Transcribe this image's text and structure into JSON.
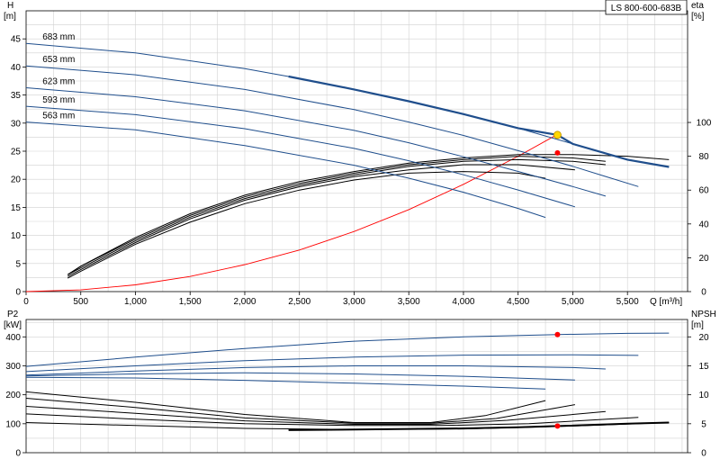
{
  "title": "LS 800-600-683B",
  "colors": {
    "blue": "#1f4e8c",
    "black": "#000000",
    "grid": "#d2d2d2",
    "red": "#ff0000",
    "opPoint": "#ffd700"
  },
  "chart_data": [
    {
      "type": "line",
      "name": "head-efficiency",
      "xlabel": "Q [m³/h]",
      "ylabel_left": "H",
      "ylabel_left_unit": "[m]",
      "ylabel_right": "eta",
      "ylabel_right_unit": "[%]",
      "xlim": [
        0,
        6050
      ],
      "ylim_left": [
        0,
        50
      ],
      "ylim_right": [
        0,
        166
      ],
      "x_ticks": [
        "0",
        "500",
        "1,000",
        "1,500",
        "2,000",
        "2,500",
        "3,000",
        "3,500",
        "4,000",
        "4,500",
        "5,000",
        "5,500"
      ],
      "x_tick_values": [
        0,
        500,
        1000,
        1500,
        2000,
        2500,
        3000,
        3500,
        4000,
        4500,
        5000,
        5500
      ],
      "y_left_ticks": [
        "0",
        "5",
        "10",
        "15",
        "20",
        "25",
        "30",
        "35",
        "40",
        "45"
      ],
      "y_left_tick_values": [
        0,
        5,
        10,
        15,
        20,
        25,
        30,
        35,
        40,
        45
      ],
      "y_right_ticks": [
        "0",
        "20",
        "40",
        "60",
        "80",
        "100"
      ],
      "y_right_tick_values": [
        0,
        20,
        40,
        60,
        80,
        100
      ],
      "head_curves": [
        {
          "name": "683 mm",
          "x": [
            0,
            1000,
            2000,
            2400,
            3000,
            3500,
            4000,
            4500,
            5000,
            5500,
            5880
          ],
          "y": [
            44.2,
            42.5,
            39.7,
            38.3,
            36.0,
            33.9,
            31.6,
            29.1,
            26.3,
            23.5,
            22.2
          ]
        },
        {
          "name": "653 mm",
          "x": [
            0,
            1000,
            2000,
            3000,
            3500,
            4000,
            4500,
            5000,
            5300,
            5600
          ],
          "y": [
            40.2,
            38.6,
            36.0,
            32.4,
            30.2,
            27.8,
            25.1,
            22.3,
            20.5,
            18.7
          ]
        },
        {
          "name": "623 mm",
          "x": [
            0,
            1000,
            2000,
            3000,
            3500,
            4000,
            4500,
            5000,
            5300
          ],
          "y": [
            36.3,
            34.7,
            32.2,
            28.7,
            26.5,
            24.0,
            21.4,
            18.7,
            17.0
          ]
        },
        {
          "name": "593 mm",
          "x": [
            0,
            1000,
            2000,
            3000,
            3500,
            4000,
            4500,
            5020
          ],
          "y": [
            33.0,
            31.5,
            29.0,
            25.5,
            23.3,
            20.8,
            18.1,
            15.1
          ]
        },
        {
          "name": "563 mm",
          "x": [
            0,
            1000,
            2000,
            3000,
            3500,
            4000,
            4500,
            4750
          ],
          "y": [
            30.2,
            28.8,
            26.0,
            22.5,
            20.2,
            17.7,
            14.8,
            13.2
          ]
        }
      ],
      "highlight_curve": {
        "name": "683 mm",
        "x": [
          2400,
          3000,
          3500,
          4000,
          4500,
          4860,
          5000,
          5500,
          5880
        ],
        "y": [
          38.3,
          36.0,
          33.9,
          31.6,
          29.1,
          27.9,
          26.3,
          23.5,
          22.2
        ]
      },
      "efficiency_curves": [
        {
          "x": [
            380,
            500,
            1000,
            1500,
            2000,
            2500,
            3000,
            3500,
            4000,
            4500,
            5000,
            5500,
            5880
          ],
          "eta": [
            10,
            15,
            32,
            46,
            57,
            65,
            71,
            76,
            79,
            81,
            81,
            80,
            78
          ]
        },
        {
          "x": [
            380,
            500,
            1000,
            1500,
            2000,
            2500,
            3000,
            3500,
            4000,
            4500,
            5000,
            5300
          ],
          "eta": [
            10,
            15,
            31,
            45,
            56,
            64,
            70,
            75,
            78,
            80,
            79,
            77
          ]
        },
        {
          "x": [
            380,
            500,
            1000,
            1500,
            2000,
            2500,
            3000,
            3500,
            4000,
            4500,
            5000,
            5300
          ],
          "eta": [
            10,
            14,
            30,
            44,
            55,
            63,
            69,
            74,
            77,
            78,
            77,
            75
          ]
        },
        {
          "x": [
            380,
            500,
            1000,
            1500,
            2000,
            2500,
            3000,
            3500,
            4000,
            4500,
            5020
          ],
          "eta": [
            9,
            13,
            29,
            43,
            54,
            62,
            68,
            72,
            75,
            75,
            72
          ]
        },
        {
          "x": [
            380,
            500,
            1000,
            1500,
            2000,
            2500,
            3000,
            3500,
            4000,
            4500,
            4750
          ],
          "eta": [
            8,
            12,
            28,
            41,
            52,
            60,
            66,
            70,
            71,
            70,
            67
          ]
        }
      ],
      "system_curve": {
        "x": [
          0,
          500,
          1000,
          1500,
          2000,
          2500,
          3000,
          3500,
          4000,
          4500,
          4860
        ],
        "y": [
          0,
          0.3,
          1.2,
          2.7,
          4.8,
          7.4,
          10.7,
          14.6,
          19.1,
          24.1,
          28.0
        ]
      },
      "operating_point": {
        "x": 4860,
        "y": 27.9,
        "eta": 82
      }
    },
    {
      "type": "line",
      "name": "power-npsh",
      "ylabel_left": "P2",
      "ylabel_left_unit": "[kW]",
      "ylabel_right": "NPSH",
      "ylabel_right_unit": "[m]",
      "xlim": [
        0,
        6050
      ],
      "ylim_left": [
        0,
        460
      ],
      "ylim_right": [
        0,
        23
      ],
      "y_left_ticks": [
        "0",
        "100",
        "200",
        "300",
        "400"
      ],
      "y_left_tick_values": [
        0,
        100,
        200,
        300,
        400
      ],
      "y_right_ticks": [
        "0",
        "5",
        "10",
        "15",
        "20"
      ],
      "y_right_tick_values": [
        0,
        5,
        10,
        15,
        20
      ],
      "power_curves": [
        {
          "x": [
            0,
            1000,
            2000,
            3000,
            4000,
            4860,
            5500,
            5880
          ],
          "y": [
            298,
            330,
            360,
            385,
            400,
            408,
            412,
            413
          ]
        },
        {
          "x": [
            0,
            1000,
            2000,
            3000,
            4000,
            5000,
            5600
          ],
          "y": [
            280,
            300,
            318,
            330,
            337,
            338,
            336
          ]
        },
        {
          "x": [
            0,
            1000,
            2000,
            3000,
            4000,
            5000,
            5300
          ],
          "y": [
            268,
            282,
            294,
            300,
            300,
            294,
            289
          ]
        },
        {
          "x": [
            0,
            1000,
            2000,
            3000,
            4000,
            5020
          ],
          "y": [
            265,
            272,
            276,
            272,
            264,
            251
          ]
        },
        {
          "x": [
            0,
            1000,
            2000,
            3000,
            4000,
            4750
          ],
          "y": [
            260,
            258,
            250,
            240,
            230,
            220
          ]
        }
      ],
      "npsh_curves": [
        {
          "x": [
            0,
            1000,
            2000,
            3000,
            3700,
            4200,
            4750
          ],
          "y": [
            10.5,
            8.7,
            6.6,
            5.2,
            5.2,
            6.4,
            9.0
          ]
        },
        {
          "x": [
            0,
            1000,
            2000,
            3000,
            3700,
            4300,
            5020
          ],
          "y": [
            9.4,
            7.8,
            6.0,
            5.1,
            5.1,
            5.9,
            8.3
          ]
        },
        {
          "x": [
            0,
            1000,
            2000,
            3000,
            3700,
            4400,
            5300
          ],
          "y": [
            8.0,
            6.8,
            5.5,
            4.9,
            4.9,
            5.6,
            7.1
          ]
        },
        {
          "x": [
            0,
            1000,
            2000,
            3000,
            3800,
            4600,
            5600
          ],
          "y": [
            6.7,
            5.8,
            5.0,
            4.7,
            4.7,
            5.0,
            6.1
          ]
        },
        {
          "x": [
            0,
            1000,
            2000,
            3000,
            4000,
            5000,
            5880
          ],
          "y": [
            5.2,
            4.7,
            4.2,
            4.0,
            4.1,
            4.6,
            5.2
          ]
        }
      ],
      "npsh_highlight": {
        "x": [
          2400,
          3000,
          3500,
          4000,
          4500,
          4860,
          5500,
          5880
        ],
        "y": [
          3.9,
          4.0,
          4.1,
          4.2,
          4.4,
          4.6,
          5.0,
          5.2
        ]
      },
      "power_point": {
        "x": 4860,
        "y": 408
      },
      "npsh_point": {
        "x": 4860,
        "y": 4.6
      }
    }
  ]
}
